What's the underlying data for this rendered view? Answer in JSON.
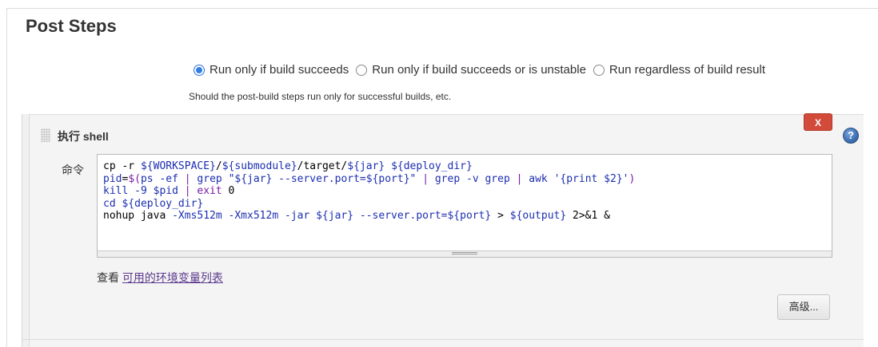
{
  "section": {
    "title": "Post Steps"
  },
  "run_condition": {
    "options": [
      {
        "label": "Run only if build succeeds",
        "checked": true
      },
      {
        "label": "Run only if build succeeds or is unstable",
        "checked": false
      },
      {
        "label": "Run regardless of build result",
        "checked": false
      }
    ],
    "help_text": "Should the post-build steps run only for successful builds, etc."
  },
  "step": {
    "title": "执行 shell",
    "delete_label": "X",
    "help_icon_label": "?",
    "command_label": "命令",
    "command_lines": [
      "cp -r ${WORKSPACE}/${submodule}/target/${jar} ${deploy_dir}",
      "pid=$(ps -ef | grep \"${jar} --server.port=${port}\" | grep -v grep | awk '{print $2}')",
      "kill -9 $pid | exit 0",
      "cd ${deploy_dir}",
      "nohup java -Xms512m -Xmx512m -jar ${jar} --server.port=${port} > ${output} 2>&1 &"
    ],
    "env_prefix": "查看",
    "env_link": "可用的环境变量列表",
    "advanced_label": "高级..."
  },
  "colors": {
    "delete_button": "#d24a3a",
    "radio_accent": "#2f7fe6",
    "link": "#5b3a8c",
    "code_variable": "#1c2fb0"
  },
  "icons": {
    "delete": "close-icon",
    "help": "help-icon",
    "drag": "drag-handle-icon"
  }
}
